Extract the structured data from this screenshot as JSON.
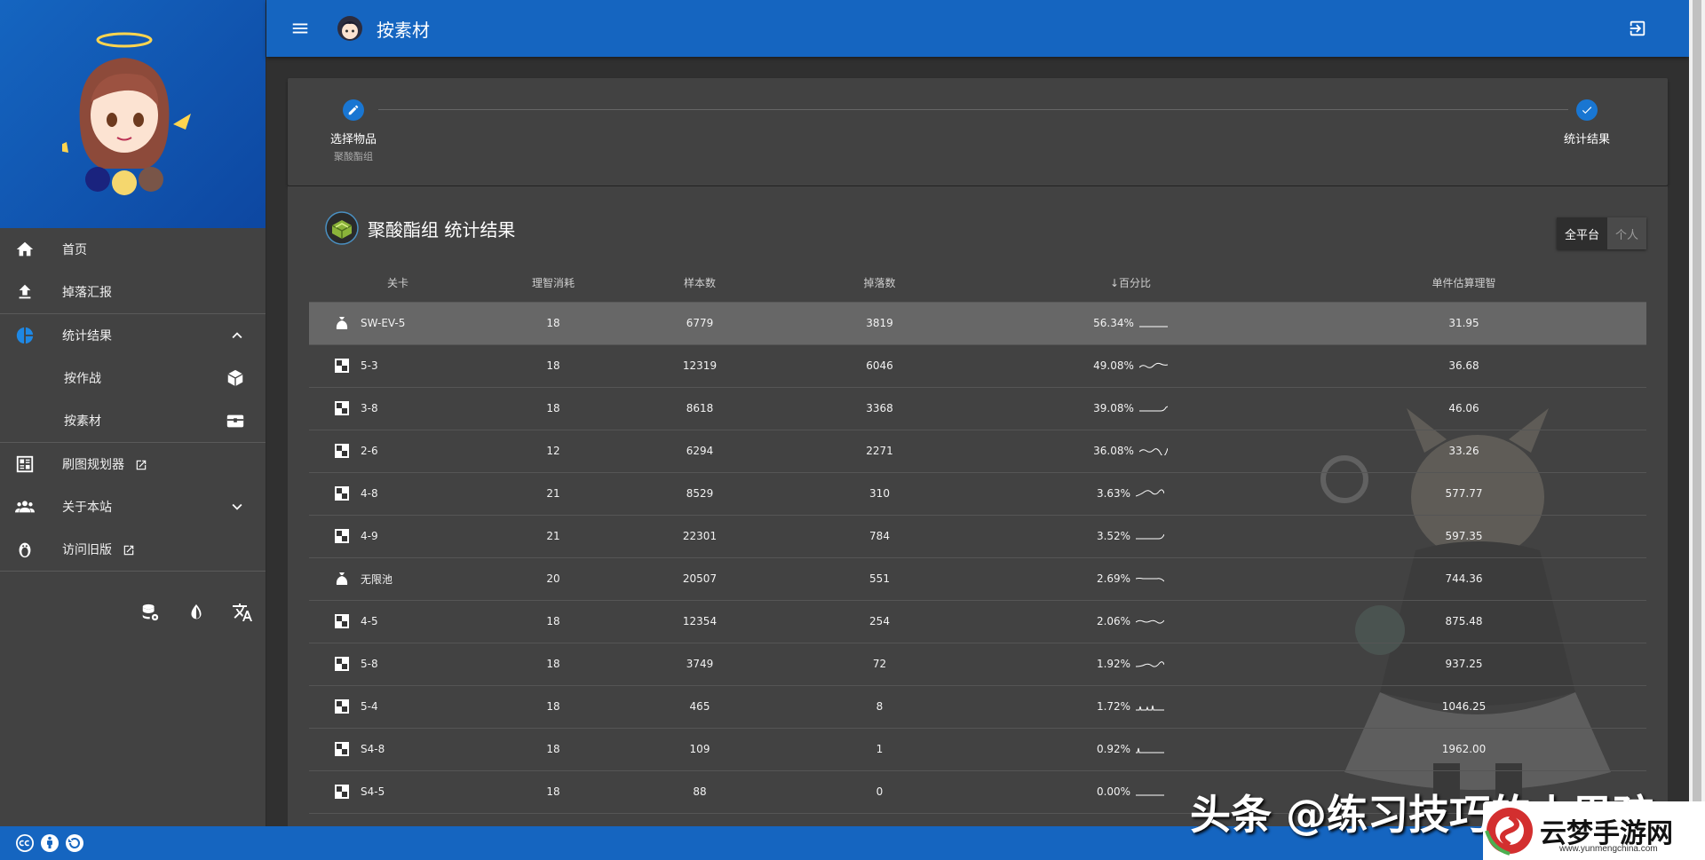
{
  "app": {
    "page_title": "按素材"
  },
  "sidebar": {
    "items": [
      {
        "label": "首页"
      },
      {
        "label": "掉落汇报"
      },
      {
        "label": "统计结果"
      },
      {
        "label": "按作战"
      },
      {
        "label": "按素材"
      },
      {
        "label": "刷图规划器"
      },
      {
        "label": "关于本站"
      },
      {
        "label": "访问旧版"
      }
    ]
  },
  "stepper": {
    "step1_title": "选择物品",
    "step1_sub": "聚酸酯组",
    "step2_title": "统计结果"
  },
  "results": {
    "title": "聚酸酯组 统计结果",
    "toggle_all": "全平台",
    "toggle_personal": "个人",
    "columns": [
      "关卡",
      "理智消耗",
      "样本数",
      "掉落数",
      "百分比",
      "单件估算理智"
    ],
    "sort_arrow": "↓",
    "rows": [
      {
        "stage": "SW-EV-5",
        "icon": "event-bag-icon",
        "cost": "18",
        "samples": "6779",
        "drops": "3819",
        "pct": "56.34%",
        "ap": "31.95"
      },
      {
        "stage": "5-3",
        "icon": "main-stage-icon",
        "cost": "18",
        "samples": "12319",
        "drops": "6046",
        "pct": "49.08%",
        "ap": "36.68"
      },
      {
        "stage": "3-8",
        "icon": "main-stage-icon",
        "cost": "18",
        "samples": "8618",
        "drops": "3368",
        "pct": "39.08%",
        "ap": "46.06"
      },
      {
        "stage": "2-6",
        "icon": "main-stage-icon",
        "cost": "12",
        "samples": "6294",
        "drops": "2271",
        "pct": "36.08%",
        "ap": "33.26"
      },
      {
        "stage": "4-8",
        "icon": "main-stage-icon",
        "cost": "21",
        "samples": "8529",
        "drops": "310",
        "pct": "3.63%",
        "ap": "577.77"
      },
      {
        "stage": "4-9",
        "icon": "main-stage-icon",
        "cost": "21",
        "samples": "22301",
        "drops": "784",
        "pct": "3.52%",
        "ap": "597.35"
      },
      {
        "stage": "无限池",
        "icon": "event-bag-icon",
        "cost": "20",
        "samples": "20507",
        "drops": "551",
        "pct": "2.69%",
        "ap": "744.36"
      },
      {
        "stage": "4-5",
        "icon": "main-stage-icon",
        "cost": "18",
        "samples": "12354",
        "drops": "254",
        "pct": "2.06%",
        "ap": "875.48"
      },
      {
        "stage": "5-8",
        "icon": "main-stage-icon",
        "cost": "18",
        "samples": "3749",
        "drops": "72",
        "pct": "1.92%",
        "ap": "937.25"
      },
      {
        "stage": "5-4",
        "icon": "main-stage-icon",
        "cost": "18",
        "samples": "465",
        "drops": "8",
        "pct": "1.72%",
        "ap": "1046.25"
      },
      {
        "stage": "S4-8",
        "icon": "main-stage-icon",
        "cost": "18",
        "samples": "109",
        "drops": "1",
        "pct": "0.92%",
        "ap": "1962.00"
      },
      {
        "stage": "S4-5",
        "icon": "main-stage-icon",
        "cost": "18",
        "samples": "88",
        "drops": "0",
        "pct": "0.00%",
        "ap": ""
      }
    ]
  },
  "watermark": {
    "text": "头条 @练习技巧的小男孩",
    "brand": "云梦手游网",
    "url": "www.yunmengchina.com"
  },
  "colors": {
    "primary": "#1565c0",
    "card": "#424242",
    "background": "#303030",
    "highlight_row": "#676767"
  }
}
